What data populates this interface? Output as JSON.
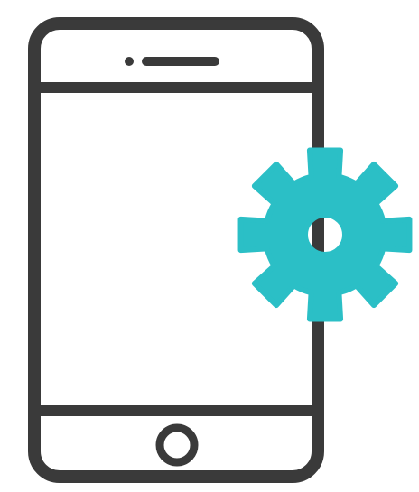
{
  "icon": {
    "name": "mobile-settings-icon",
    "parts": [
      "smartphone-icon",
      "gear-icon"
    ]
  },
  "colors": {
    "background": "#ffffff",
    "phone_outline": "#3a3a3a",
    "gear": "#2bbfc6",
    "gear_hole": "#ffffff"
  }
}
